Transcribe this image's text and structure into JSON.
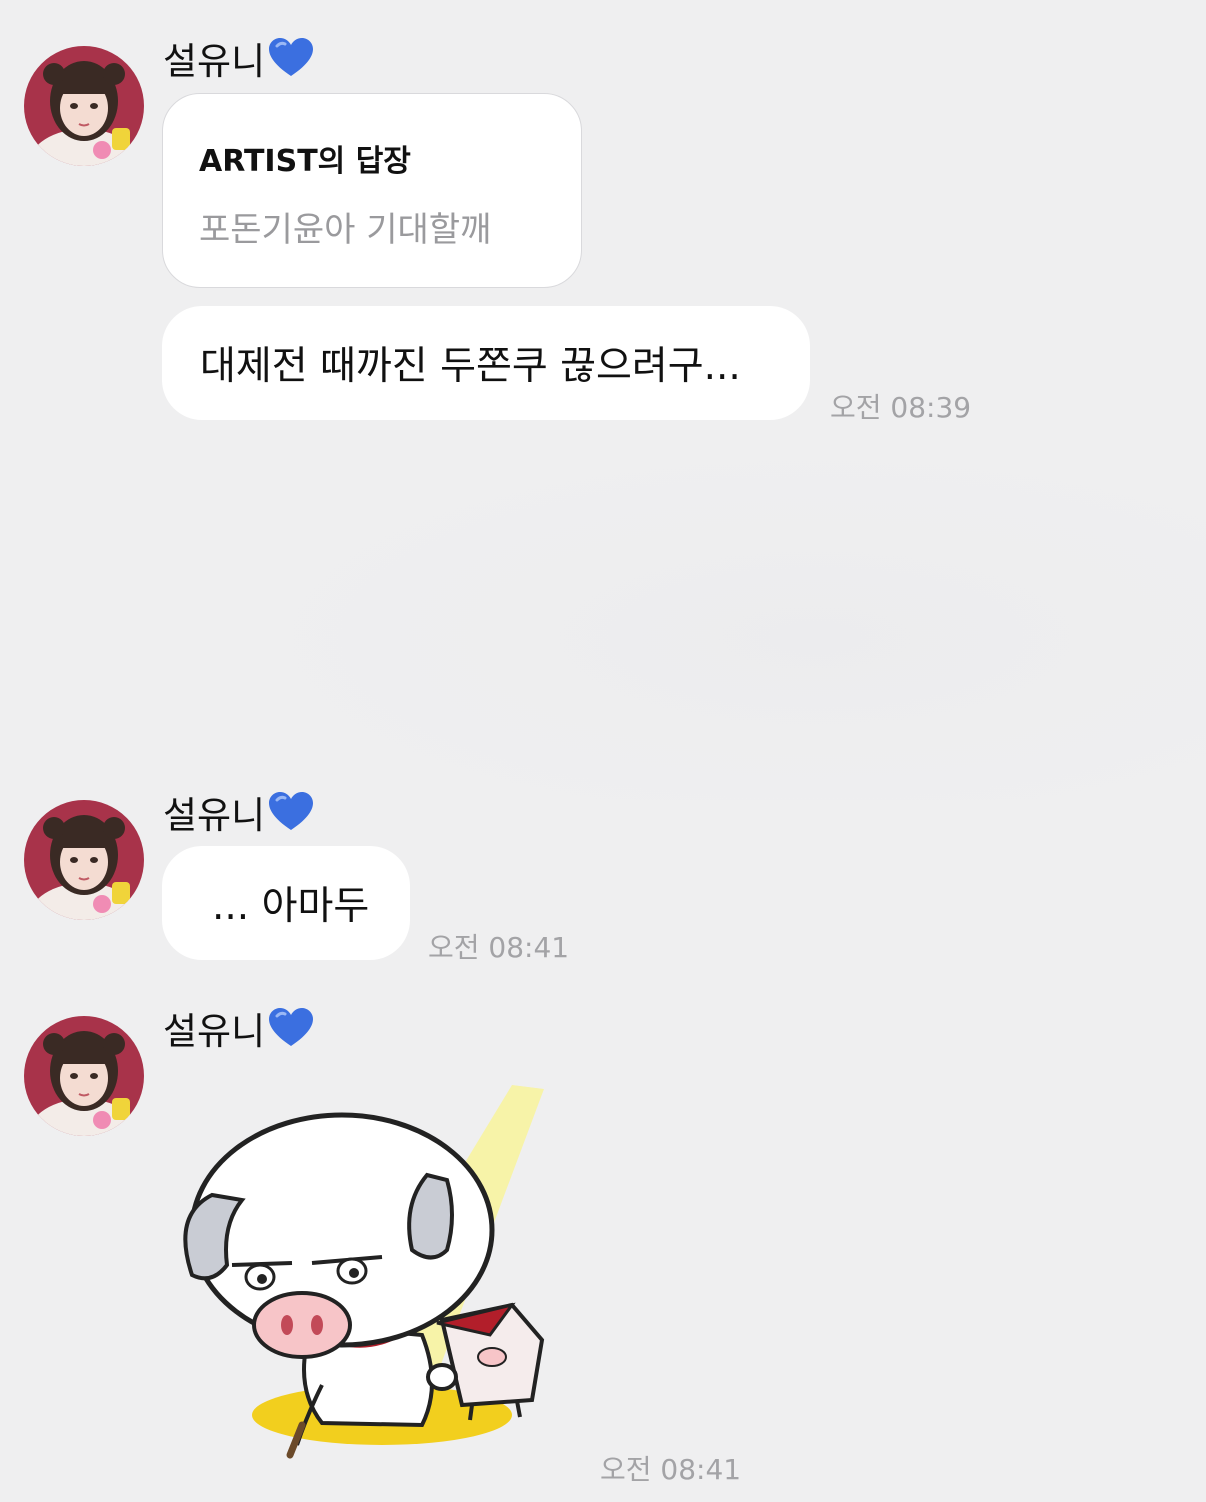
{
  "colors": {
    "background": "#efeff0",
    "bubble": "#ffffff",
    "timestamp": "#a3a3a6",
    "heart": "#3b6fe0",
    "reply_text": "#9a9a9d"
  },
  "messages": [
    {
      "sender": "설유니",
      "sender_icon": "blue-heart-icon",
      "reply": {
        "title": "ARTIST의 답장",
        "quoted_text": "포돈기윤아 기대할깨"
      },
      "text": "대제전 때까진 두쫀쿠 끊으려구...",
      "time": "오전 08:39"
    },
    {
      "sender": "설유니",
      "sender_icon": "blue-heart-icon",
      "text": "... 아마두",
      "time": "오전 08:41"
    },
    {
      "sender": "설유니",
      "sender_icon": "blue-heart-icon",
      "sticker": "pig-sticker",
      "time": "오전 08:41"
    }
  ]
}
